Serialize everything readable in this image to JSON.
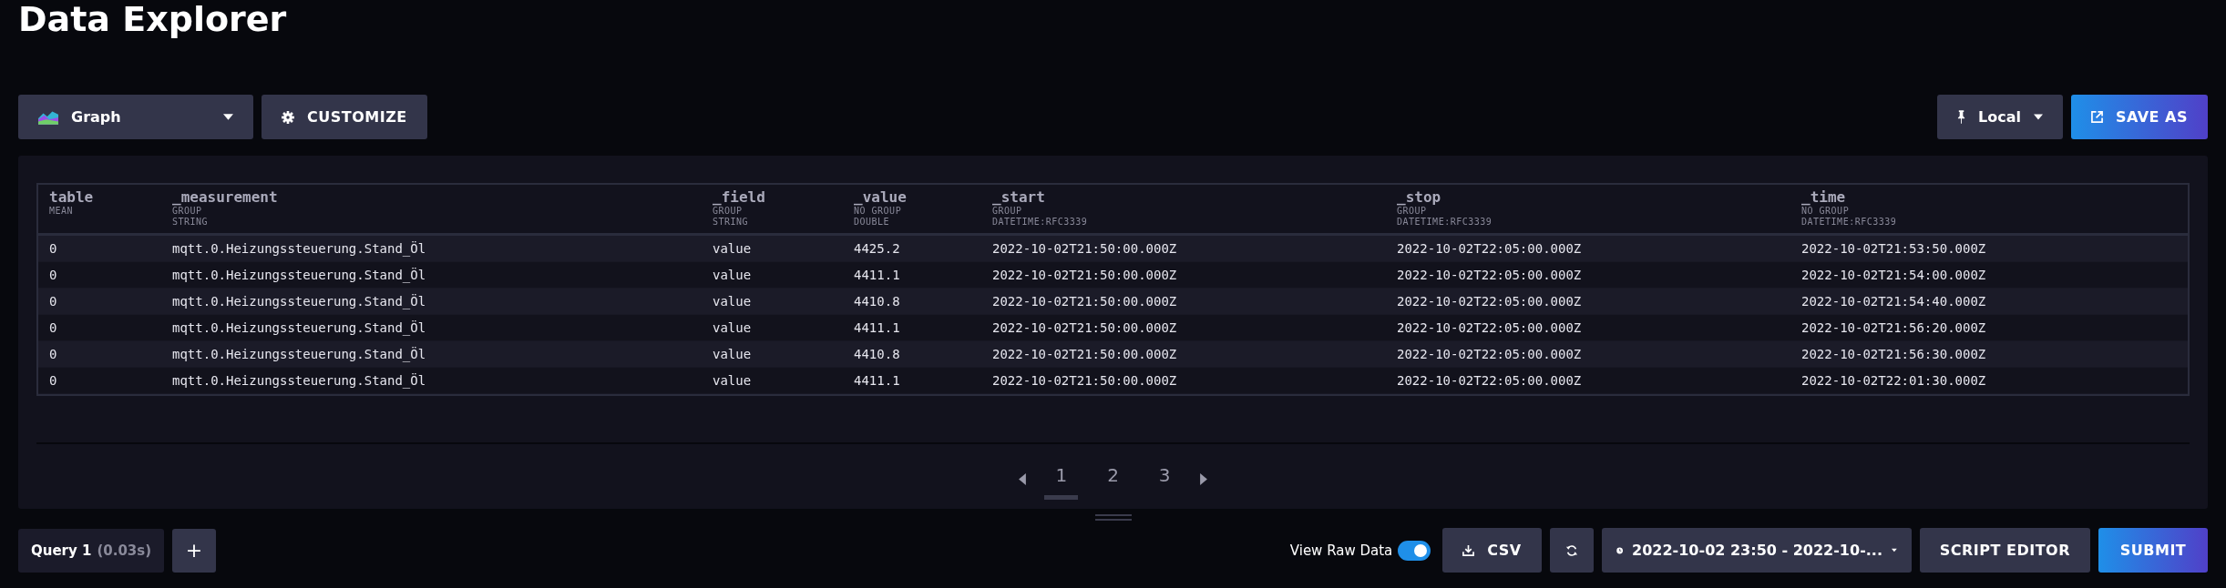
{
  "page_title": "Data Explorer",
  "toolbar": {
    "view_type": "Graph",
    "customize": "CUSTOMIZE",
    "timezone": "Local",
    "save_as": "SAVE AS"
  },
  "table": {
    "columns": [
      {
        "name": "table",
        "group": "MEAN"
      },
      {
        "name": "_measurement",
        "group": "GROUP",
        "type": "STRING"
      },
      {
        "name": "_field",
        "group": "GROUP",
        "type": "STRING"
      },
      {
        "name": "_value",
        "group": "NO GROUP",
        "type": "DOUBLE"
      },
      {
        "name": "_start",
        "group": "GROUP",
        "type": "DATETIME:RFC3339"
      },
      {
        "name": "_stop",
        "group": "GROUP",
        "type": "DATETIME:RFC3339"
      },
      {
        "name": "_time",
        "group": "NO GROUP",
        "type": "DATETIME:RFC3339"
      }
    ],
    "rows": [
      [
        "0",
        "mqtt.0.Heizungssteuerung.Stand_Öl",
        "value",
        "4425.2",
        "2022-10-02T21:50:00.000Z",
        "2022-10-02T22:05:00.000Z",
        "2022-10-02T21:53:50.000Z"
      ],
      [
        "0",
        "mqtt.0.Heizungssteuerung.Stand_Öl",
        "value",
        "4411.1",
        "2022-10-02T21:50:00.000Z",
        "2022-10-02T22:05:00.000Z",
        "2022-10-02T21:54:00.000Z"
      ],
      [
        "0",
        "mqtt.0.Heizungssteuerung.Stand_Öl",
        "value",
        "4410.8",
        "2022-10-02T21:50:00.000Z",
        "2022-10-02T22:05:00.000Z",
        "2022-10-02T21:54:40.000Z"
      ],
      [
        "0",
        "mqtt.0.Heizungssteuerung.Stand_Öl",
        "value",
        "4411.1",
        "2022-10-02T21:50:00.000Z",
        "2022-10-02T22:05:00.000Z",
        "2022-10-02T21:56:20.000Z"
      ],
      [
        "0",
        "mqtt.0.Heizungssteuerung.Stand_Öl",
        "value",
        "4410.8",
        "2022-10-02T21:50:00.000Z",
        "2022-10-02T22:05:00.000Z",
        "2022-10-02T21:56:30.000Z"
      ],
      [
        "0",
        "mqtt.0.Heizungssteuerung.Stand_Öl",
        "value",
        "4411.1",
        "2022-10-02T21:50:00.000Z",
        "2022-10-02T22:05:00.000Z",
        "2022-10-02T22:01:30.000Z"
      ]
    ]
  },
  "pagination": [
    {
      "label": "1",
      "selected": true
    },
    {
      "label": "2",
      "selected": false
    },
    {
      "label": "3",
      "selected": false
    }
  ],
  "query_tab": {
    "label": "Query 1",
    "time": "(0.03s)",
    "add": "+"
  },
  "view_raw_data": {
    "label": "View Raw Data",
    "on": true
  },
  "bottom_bar": {
    "csv": "CSV",
    "time_range": "2022-10-02 23:50 - 2022-10-...",
    "script_editor": "SCRIPT EDITOR",
    "submit": "SUBMIT"
  }
}
